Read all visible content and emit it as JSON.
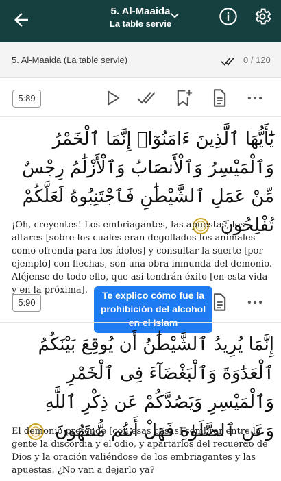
{
  "header": {
    "title": "5. Al-Maaida",
    "subtitle": "La table servie",
    "back_icon": "arrow-left-icon",
    "dropdown_icon": "chevron-down-icon",
    "info_icon": "info-icon",
    "settings_icon": "gear-icon",
    "bg_color": "#15403f"
  },
  "surah_bar": {
    "name": "5. Al-Maaida (La table servie)",
    "progress": "0 / 120"
  },
  "verses": [
    {
      "number": "5:89",
      "arabic": "يَٰٓأَيُّهَا ٱلَّذِينَ ءَامَنُوٓا۟ إِنَّمَا ٱلْخَمْرُ وَٱلْمَيْسِرُ وَٱلْأَنصَابُ وَٱلْأَزْلَٰمُ رِجْسٌ مِّنْ عَمَلِ ٱلشَّيْطَٰنِ فَٱجْتَنِبُوهُ لَعَلَّكُمْ تُفْلِحُونَ",
      "translation": "¡Oh, creyentes! Los embriagantes, las apuestas, los altares [sobre los cuales eran degollados los animales como ofrenda para los ídolos] y consultar la suerte [por ejemplo] con flechas, son una obra inmunda del demonio. Aléjense de todo ello, que así tendrán éxito [en esta vida y en la próxima]."
    },
    {
      "number": "5:90",
      "arabic": "إِنَّمَا يُرِيدُ ٱلشَّيْطَٰنُ أَن يُوقِعَ بَيْنَكُمُ ٱلْعَدَٰوَةَ وَٱلْبَغْضَآءَ فِى ٱلْخَمْرِ وَٱلْمَيْسِرِ وَيَصُدَّكُمْ عَن ذِكْرِ ٱللَّهِ وَعَنِ ٱلصَّلَوٰةِ فَهَلْ أَنتُم مُّنتَهُونَ",
      "translation": "El demonio pretende [con esas cosas] sembrar entre la gente la discordia y el odio, y apartarlos del recuerdo de Dios y la oración valiéndose de los embriagantes y las apuestas. ¿No van a dejarlo ya?"
    }
  ],
  "tooltip": {
    "text": "Te explico cómo fue la prohibición del alcohol en el Islam",
    "color": "#1f7bf2"
  },
  "actions": {
    "play_icon": "play-icon",
    "tafsir_icon": "double-check-icon",
    "bookmark_icon": "bookmark-plus-icon",
    "note_icon": "document-icon",
    "more_icon": "more-icon"
  }
}
